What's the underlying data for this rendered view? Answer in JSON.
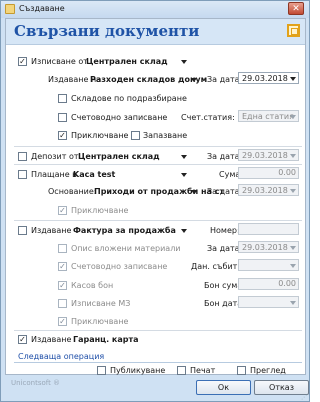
{
  "window": {
    "title": "Създаване"
  },
  "header": {
    "title": "Свързани документи"
  },
  "section1": {
    "label": "Изписване от",
    "value": "Централен склад",
    "doc_label": "Издаване на",
    "doc_value": "Разходен складов докум",
    "date_label": "За дата:",
    "date_value": "29.03.2018",
    "opt_defaults": "Складове по подразбиране",
    "opt_accounting": "Счетоводно записване",
    "status_label": "Счет.статия:",
    "status_value": "Една статия",
    "opt_finish": "Приключване",
    "opt_save": "Запазване"
  },
  "section2": {
    "label": "Депозит от",
    "value": "Централен склад",
    "date_label": "За дата:",
    "date_value": "29.03.2018"
  },
  "section3": {
    "label": "Плащане в",
    "value": "Kaca test",
    "sum_label": "Сума:",
    "sum_value": "0.00",
    "basis_label": "Основание:",
    "basis_value": "Приходи от продажби на ст",
    "date_label": "За дата:",
    "date_value": "29.03.2018",
    "opt_finish": "Приключване"
  },
  "section4": {
    "label": "Издаване",
    "value": "Фактура за продажба",
    "number_label": "Номер:",
    "number_value": "",
    "opt_desc": "Опис вложени материали",
    "opt_accounting": "Счетоводно записване",
    "opt_cash": "Касов бон",
    "opt_m3": "Изписване МЗ",
    "opt_finish": "Приключване",
    "date_label": "За дата:",
    "date_value": "29.03.2018",
    "tax_label": "Дан. събитие:",
    "tax_value": "",
    "bon_sum_label": "Бон сума:",
    "bon_sum_value": "0.00",
    "bon_date_label": "Бон дата:",
    "bon_date_value": ""
  },
  "section5": {
    "label": "Издаване",
    "value": "Гаранц. карта"
  },
  "next_operation": "Следваща операция",
  "bottom_options": {
    "publish": "Публикуване",
    "print": "Печат",
    "preview": "Преглед"
  },
  "brand": "Unicontsoft ®",
  "buttons": {
    "ok": "Ок",
    "cancel": "Отказ"
  },
  "checks": {
    "checked": "✓"
  }
}
